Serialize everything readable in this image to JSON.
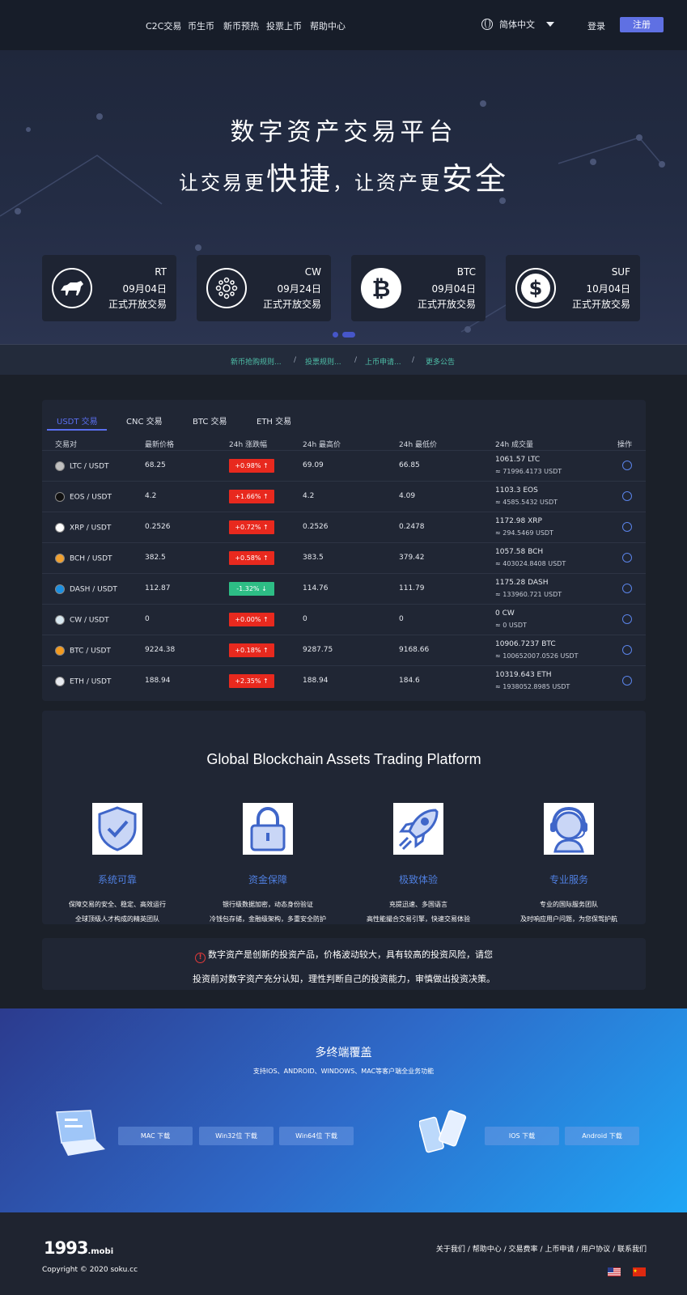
{
  "nav": {
    "items": [
      "C2C交易",
      "币生币",
      "新币预热",
      "投票上币",
      "帮助中心"
    ],
    "language": "简体中文",
    "login": "登录",
    "register": "注册"
  },
  "hero": {
    "title": "数字资产交易平台",
    "sub_part1": "让交易更",
    "sub_big1": "快捷",
    "sub_part2": "，让资产更",
    "sub_big2": "安全"
  },
  "listing_cards": [
    {
      "symbol": "RT",
      "date": "09月04日",
      "status": "正式开放交易",
      "icon": "bull-icon"
    },
    {
      "symbol": "CW",
      "date": "09月24日",
      "status": "正式开放交易",
      "icon": "cw-coin-icon"
    },
    {
      "symbol": "BTC",
      "date": "09月04日",
      "status": "正式开放交易",
      "icon": "bitcoin-icon"
    },
    {
      "symbol": "SUF",
      "date": "10月04日",
      "status": "正式开放交易",
      "icon": "suf-coin-icon"
    }
  ],
  "notices": [
    "新币抢购规则...",
    "投票规则...",
    "上币申请...",
    "更多公告"
  ],
  "notice_separator": "/",
  "market": {
    "tabs": [
      "USDT 交易",
      "CNC 交易",
      "BTC 交易",
      "ETH 交易"
    ],
    "active_tab": 0,
    "headers": [
      "交易对",
      "最新价格",
      "24h 涨跌幅",
      "24h 最高价",
      "24h 最低价",
      "24h 成交量",
      "操作"
    ],
    "rows": [
      {
        "pair": "LTC / USDT",
        "price": "68.25",
        "change": "+0.98% ↑",
        "dir": "up",
        "high": "69.09",
        "low": "66.85",
        "vol": "1061.57 LTC",
        "vol_usdt": "≈ 71996.4173 USDT",
        "icon_color": "#bfbfbf"
      },
      {
        "pair": "EOS / USDT",
        "price": "4.2",
        "change": "+1.66% ↑",
        "dir": "up",
        "high": "4.2",
        "low": "4.09",
        "vol": "1103.3 EOS",
        "vol_usdt": "≈ 4585.5432 USDT",
        "icon_color": "#111111"
      },
      {
        "pair": "XRP / USDT",
        "price": "0.2526",
        "change": "+0.72% ↑",
        "dir": "up",
        "high": "0.2526",
        "low": "0.2478",
        "vol": "1172.98 XRP",
        "vol_usdt": "≈ 294.5469 USDT",
        "icon_color": "#ffffff"
      },
      {
        "pair": "BCH / USDT",
        "price": "382.5",
        "change": "+0.58% ↑",
        "dir": "up",
        "high": "383.5",
        "low": "379.42",
        "vol": "1057.58 BCH",
        "vol_usdt": "≈ 403024.8408 USDT",
        "icon_color": "#f0a030"
      },
      {
        "pair": "DASH / USDT",
        "price": "112.87",
        "change": "-1.32% ↓",
        "dir": "down",
        "high": "114.76",
        "low": "111.79",
        "vol": "1175.28 DASH",
        "vol_usdt": "≈ 133960.721 USDT",
        "icon_color": "#1c8fe0"
      },
      {
        "pair": "CW / USDT",
        "price": "0",
        "change": "+0.00% ↑",
        "dir": "up",
        "high": "0",
        "low": "0",
        "vol": "0 CW",
        "vol_usdt": "≈ 0 USDT",
        "icon_color": "#d8e8f0"
      },
      {
        "pair": "BTC / USDT",
        "price": "9224.38",
        "change": "+0.18% ↑",
        "dir": "up",
        "high": "9287.75",
        "low": "9168.66",
        "vol": "10906.7237 BTC",
        "vol_usdt": "≈ 100652007.0526 USDT",
        "icon_color": "#f39a1f"
      },
      {
        "pair": "ETH / USDT",
        "price": "188.94",
        "change": "+2.35% ↑",
        "dir": "up",
        "high": "188.94",
        "low": "184.6",
        "vol": "10319.643 ETH",
        "vol_usdt": "≈ 1938052.8985 USDT",
        "icon_color": "#e8eaf0"
      }
    ]
  },
  "features": {
    "title": "Global Blockchain Assets Trading Platform",
    "items": [
      {
        "name": "系统可靠",
        "desc1": "保障交易的安全、稳定、高效运行",
        "desc2": "全球顶级人才构成的精英团队",
        "icon": "shield-check-icon"
      },
      {
        "name": "资金保障",
        "desc1": "银行级数据加密，动态身份验证",
        "desc2": "冷钱包存储，金融级架构，多重安全防护",
        "icon": "padlock-icon"
      },
      {
        "name": "极致体验",
        "desc1": "充提迅速、多国语言",
        "desc2": "高性能撮合交易引擎，快速交易体验",
        "icon": "rocket-icon"
      },
      {
        "name": "专业服务",
        "desc1": "专业的国际服务团队",
        "desc2": "及时响应用户问题，为您保驾护航",
        "icon": "support-agent-icon"
      }
    ]
  },
  "risk": {
    "line1": "数字资产是创新的投资产品，价格波动较大，具有较高的投资风险，请您",
    "line2": "投资前对数字资产充分认知，理性判断自己的投资能力，审慎做出投资决策。"
  },
  "download": {
    "title": "多终端覆盖",
    "subtitle": "支持IOS、ANDROID、WINDOWS、MAC等客户端全业务功能",
    "desktop_buttons": [
      "MAC 下载",
      "Win32位 下载",
      "Win64位 下载"
    ],
    "mobile_buttons": [
      "IOS 下载",
      "Android 下载"
    ]
  },
  "footer": {
    "logo_main": "1993",
    "logo_suffix": ".mobi",
    "copyright": "Copyright © 2020 soku.cc",
    "links": [
      "关于我们",
      "帮助中心",
      "交易费率",
      "上币申请",
      "用户协议",
      "联系我们"
    ],
    "link_separator": "/"
  },
  "colors": {
    "accent": "#5f70e3",
    "up": "#e8291e",
    "down": "#2dbd85",
    "notice_link": "#4fbfa8"
  }
}
